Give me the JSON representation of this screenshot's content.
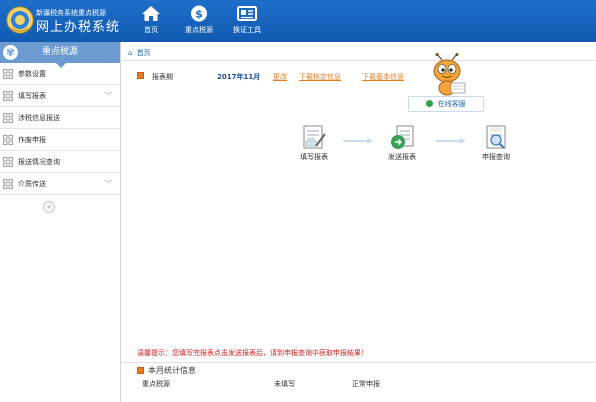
{
  "header": {
    "brand_sub": "新疆税务系统重点税源",
    "brand_main": "网上办税系统",
    "nav": [
      {
        "label": "首页",
        "icon": "home-icon"
      },
      {
        "label": "重点税源",
        "icon": "dollar-icon"
      },
      {
        "label": "换证工具",
        "icon": "certificate-icon"
      }
    ]
  },
  "sidebar": {
    "title": "重点税源",
    "items": [
      {
        "label": "参数设置",
        "expandable": false
      },
      {
        "label": "填写报表",
        "expandable": true
      },
      {
        "label": "涉税信息报送",
        "expandable": false
      },
      {
        "label": "作废申报",
        "expandable": false
      },
      {
        "label": "报送情况查询",
        "expandable": false
      },
      {
        "label": "介质传送",
        "expandable": true
      }
    ],
    "collapse_glyph": "«"
  },
  "breadcrumb": {
    "label": "首页"
  },
  "period": {
    "label": "报表期",
    "value": "2017年11月",
    "change_link": "更改",
    "download_links": [
      "下载核定信息",
      "下载基本信息"
    ]
  },
  "online_service": {
    "label": "在线客服"
  },
  "steps": [
    {
      "label": "填写报表",
      "icon": "fill-report-icon"
    },
    {
      "label": "发送报表",
      "icon": "send-report-icon"
    },
    {
      "label": "申报查询",
      "icon": "tax-query-icon"
    }
  ],
  "tip": "温馨提示：您填写完报表点击发送报表后，请到申报查询中获取申报结果！",
  "stats": {
    "title": "本月统计信息",
    "columns": [
      "重点税源",
      "未填写",
      "正常申报"
    ]
  },
  "colors": {
    "header": "#1e6fc8",
    "sidebar_head": "#6b9bd1",
    "link_orange": "#e87d1e",
    "tip_red": "#d42020"
  }
}
